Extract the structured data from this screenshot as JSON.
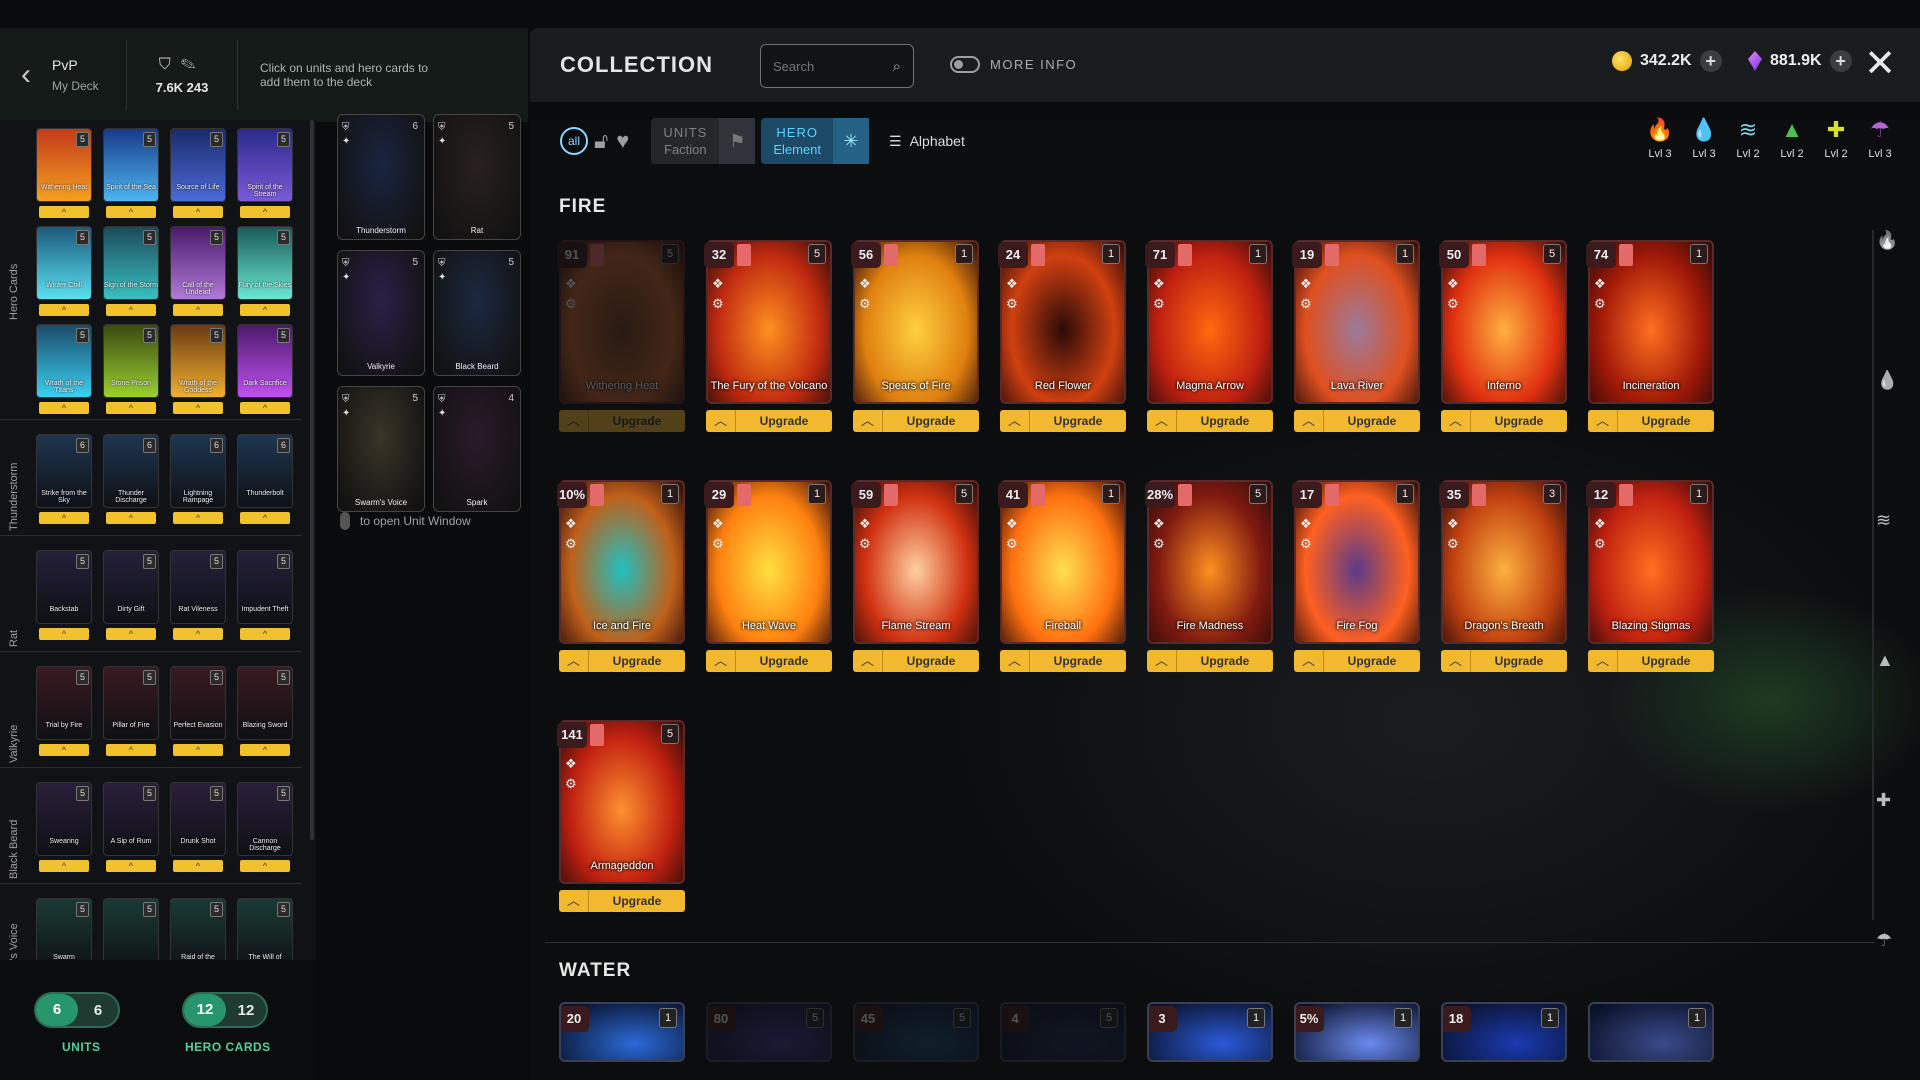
{
  "topbar": {
    "back_icon": "chevron-left-icon",
    "mode_title": "PvP",
    "mode_sub": "My Deck",
    "stat_value": "7.6K 243",
    "hint": "Click on units and hero cards to add them to the deck"
  },
  "header": {
    "title": "COLLECTION",
    "search_placeholder": "Search",
    "more_info": "MORE INFO",
    "gold": "342.2K",
    "gems": "881.9K"
  },
  "filters": {
    "units_a": "UNITS",
    "units_b": "Faction",
    "hero_a": "HERO",
    "hero_b": "Element",
    "sort": "Alphabet"
  },
  "elements": [
    {
      "glyph": "🔥",
      "color": "#e8453c",
      "level": "Lvl 3"
    },
    {
      "glyph": "💧",
      "color": "#2f7bff",
      "level": "Lvl 3"
    },
    {
      "glyph": "≋",
      "color": "#7ed6e8",
      "level": "Lvl 2"
    },
    {
      "glyph": "▲",
      "color": "#4cc34a",
      "level": "Lvl 2"
    },
    {
      "glyph": "✚",
      "color": "#d9e02a",
      "level": "Lvl 2"
    },
    {
      "glyph": "☂",
      "color": "#b565d8",
      "level": "Lvl 3"
    }
  ],
  "sidebar": {
    "groups": [
      {
        "label": "Hero Cards",
        "cards": [
          {
            "name": "Withering Heat",
            "lv": "5"
          },
          {
            "name": "Spirit of the Sea",
            "lv": "5"
          },
          {
            "name": "Source of Life",
            "lv": "5"
          },
          {
            "name": "Spirit of the Stream",
            "lv": "5"
          },
          {
            "name": "Winter Chill",
            "lv": "5"
          },
          {
            "name": "Sign of the Storm",
            "lv": "5"
          },
          {
            "name": "Call of the Undead",
            "lv": "5"
          },
          {
            "name": "Fury of the Skies",
            "lv": "5"
          },
          {
            "name": "Wrath of the Titans",
            "lv": "5"
          },
          {
            "name": "Stone Prison",
            "lv": "5"
          },
          {
            "name": "Wrath of the Goddess",
            "lv": "5"
          },
          {
            "name": "Dark Sacrifice",
            "lv": "5"
          }
        ]
      },
      {
        "label": "Thunderstorm",
        "cards": [
          {
            "name": "Strike from the Sky",
            "lv": "6"
          },
          {
            "name": "Thunder Discharge",
            "lv": "6"
          },
          {
            "name": "Lightning Rampage",
            "lv": "6"
          },
          {
            "name": "Thunderbolt",
            "lv": "6"
          }
        ]
      },
      {
        "label": "Rat",
        "cards": [
          {
            "name": "Backstab",
            "lv": "5"
          },
          {
            "name": "Dirty Gift",
            "lv": "5"
          },
          {
            "name": "Rat Vileness",
            "lv": "5"
          },
          {
            "name": "Impudent Theft",
            "lv": "5"
          }
        ]
      },
      {
        "label": "Valkyrie",
        "cards": [
          {
            "name": "Trial by Fire",
            "lv": "5"
          },
          {
            "name": "Pillar of Fire",
            "lv": "5"
          },
          {
            "name": "Perfect Evasion",
            "lv": "5"
          },
          {
            "name": "Blazing Sword",
            "lv": "5"
          }
        ]
      },
      {
        "label": "Black Beard",
        "cards": [
          {
            "name": "Swearing",
            "lv": "5"
          },
          {
            "name": "A Sip of Rum",
            "lv": "5"
          },
          {
            "name": "Drunk Shot",
            "lv": "5"
          },
          {
            "name": "Cannon Discharge",
            "lv": "5"
          }
        ]
      },
      {
        "label": "Swarm's Voice",
        "cards": [
          {
            "name": "Swarm",
            "lv": "5"
          },
          {
            "name": "",
            "lv": "5"
          },
          {
            "name": "Raid of the",
            "lv": "5"
          },
          {
            "name": "The Will of",
            "lv": "5"
          }
        ]
      }
    ]
  },
  "deck": {
    "cards": [
      {
        "name": "Thunderstorm",
        "lv": "6"
      },
      {
        "name": "Rat",
        "lv": "5"
      },
      {
        "name": "Valkyrie",
        "lv": "5"
      },
      {
        "name": "Black Beard",
        "lv": "5"
      },
      {
        "name": "Swarm's Voice",
        "lv": "5"
      },
      {
        "name": "Spark",
        "lv": "4"
      }
    ],
    "hint": "to open Unit Window"
  },
  "counters": {
    "units_a": "6",
    "units_b": "6",
    "units_label": "UNITS",
    "hero_a": "12",
    "hero_b": "12",
    "hero_label": "HERO CARDS"
  },
  "fire": {
    "title": "FIRE",
    "upgrade": "Upgrade",
    "cards": [
      {
        "name": "Withering Heat",
        "cost": "91",
        "lv": "5"
      },
      {
        "name": "The Fury of the Volcano",
        "cost": "32",
        "lv": "5"
      },
      {
        "name": "Spears of Fire",
        "cost": "56",
        "lv": "1"
      },
      {
        "name": "Red Flower",
        "cost": "24",
        "lv": "1"
      },
      {
        "name": "Magma Arrow",
        "cost": "71",
        "lv": "1"
      },
      {
        "name": "Lava River",
        "cost": "19",
        "lv": "1"
      },
      {
        "name": "Inferno",
        "cost": "50",
        "lv": "5"
      },
      {
        "name": "Incineration",
        "cost": "74",
        "lv": "1"
      },
      {
        "name": "Ice and Fire",
        "cost": "10%",
        "lv": "1"
      },
      {
        "name": "Heat Wave",
        "cost": "29",
        "lv": "1"
      },
      {
        "name": "Flame Stream",
        "cost": "59",
        "lv": "5"
      },
      {
        "name": "Fireball",
        "cost": "41",
        "lv": "1"
      },
      {
        "name": "Fire Madness",
        "cost": "28%",
        "lv": "5"
      },
      {
        "name": "Fire Fog",
        "cost": "17",
        "lv": "1"
      },
      {
        "name": "Dragon's Breath",
        "cost": "35",
        "lv": "3"
      },
      {
        "name": "Blazing Stigmas",
        "cost": "12",
        "lv": "1"
      },
      {
        "name": "Armageddon",
        "cost": "141",
        "lv": "5"
      }
    ]
  },
  "water": {
    "title": "WATER",
    "cards": [
      {
        "cost": "20",
        "lv": "1"
      },
      {
        "cost": "80",
        "lv": "5"
      },
      {
        "cost": "45",
        "lv": "5"
      },
      {
        "cost": "4",
        "lv": "5"
      },
      {
        "cost": "3",
        "lv": "1"
      },
      {
        "cost": "5%",
        "lv": "1"
      },
      {
        "cost": "18",
        "lv": "1"
      },
      {
        "cost": "",
        "lv": "1"
      }
    ]
  }
}
